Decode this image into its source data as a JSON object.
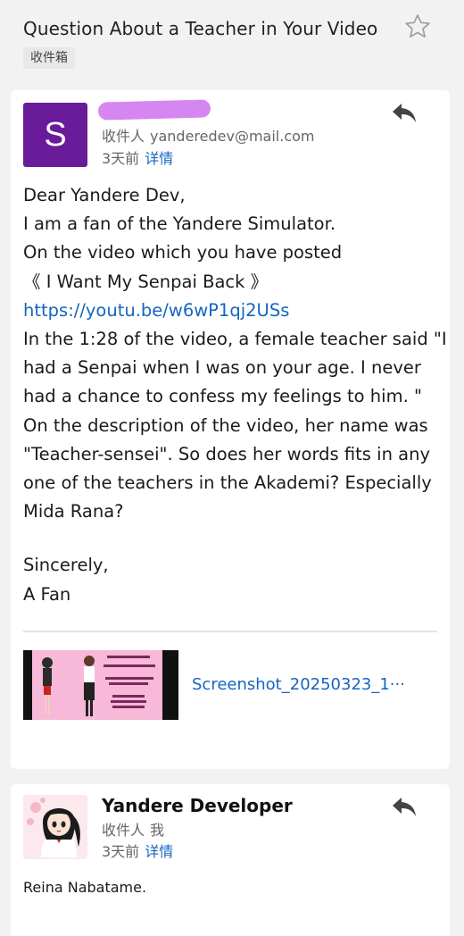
{
  "header": {
    "subject": "Question About a Teacher in Your Video",
    "folder_badge": "收件箱",
    "star_icon": "star-outline-icon"
  },
  "message1": {
    "avatar_letter": "S",
    "avatar_color": "#6a1b9a",
    "to_label": "收件人",
    "to_address": "yanderedev@mail.com",
    "time": "3天前",
    "details_link": "详情",
    "body_lines": [
      "Dear Yandere Dev,",
      "I am a fan of the Yandere Simulator.",
      "On the video which you have posted",
      "《 I Want My Senpai Back 》",
      "https://youtu.be/w6wP1qj2USs",
      "In the 1:28 of the video, a female teacher said \"I",
      "had a Senpai when I was on your age. I never",
      "had a chance to confess my feelings to him. \"",
      "On the description of the video, her name was",
      "\"Teacher-sensei\". So does her words fits in any",
      "one of the teachers in the Akademi? Especially",
      "Mida Rana?"
    ],
    "closing_lines": [
      "Sincerely,",
      "A Fan"
    ],
    "attachment_name": "Screenshot_20250323_1···"
  },
  "message2": {
    "sender_name": "Yandere Developer",
    "to_label": "收件人",
    "to_value": "我",
    "time": "3天前",
    "details_link": "详情",
    "body": "Reina Nabatame."
  },
  "colors": {
    "accent": "#1565c0",
    "background": "#f2f2f2",
    "redaction": "#d47ff0"
  }
}
